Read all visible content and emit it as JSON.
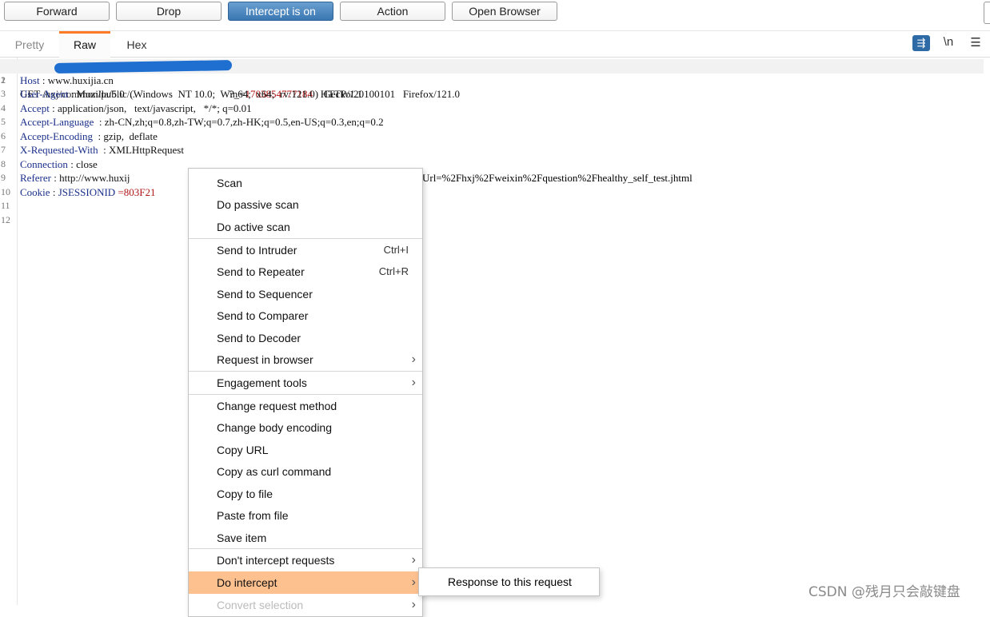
{
  "toolbar": {
    "buttons": [
      "Forward",
      "Drop",
      "Intercept is on",
      "Action",
      "Open Browser"
    ]
  },
  "tabs": [
    "Pretty",
    "Raw",
    "Hex"
  ],
  "view_icons": {
    "wrap": "wrap-lines-icon",
    "newline": "\\n",
    "menu": "☰"
  },
  "request": {
    "line_numbers": [
      "1",
      "2",
      "3",
      "4",
      "5",
      "6",
      "7",
      "8",
      "9",
      "10",
      "11",
      "12"
    ],
    "line1": {
      "method": "GET /",
      "masked": "hxj/common/public/...",
      "param": "?_=",
      "value": "1703854777184",
      "proto": "HTTP/1.1"
    },
    "headers": [
      {
        "name": "Host",
        "sep": " : ",
        "value": "www.huxijia.cn"
      },
      {
        "name": "User-Agent",
        "sep": " : ",
        "value": "Mozilla/5.0  (Windows  NT 10.0;  Win64;  x64;  rv:121.0)  Gecko/20100101   Firefox/121.0"
      },
      {
        "name": "Accept",
        "sep": " : ",
        "value": "application/json,   text/javascript,   */*; q=0.01"
      },
      {
        "name": "Accept-Language",
        "sep": "  : ",
        "value": "zh-CN,zh;q=0.8,zh-TW;q=0.7,zh-HK;q=0.5,en-US;q=0.3,en;q=0.2"
      },
      {
        "name": "Accept-Encoding",
        "sep": "  : ",
        "value": "gzip,  deflate"
      },
      {
        "name": "X-Requested-With",
        "sep": "  : ",
        "value": "XMLHttpRequest"
      },
      {
        "name": "Connection",
        "sep": " : ",
        "value": "close"
      },
      {
        "name": "Referer",
        "sep": " : ",
        "value": "http://www.huxij"
      },
      {
        "name": "Cookie",
        "sep": " : ",
        "value": ""
      }
    ],
    "referer_tail": "Url=%2Fhxj%2Fweixin%2Fquestion%2Fhealthy_self_test.jhtml",
    "cookie_name": "JSESSIONID",
    "cookie_value": "=803F21"
  },
  "context_menu": {
    "groups": [
      [
        {
          "label": "Scan"
        },
        {
          "label": "Do passive scan"
        },
        {
          "label": "Do active scan"
        }
      ],
      [
        {
          "label": "Send to Intruder",
          "shortcut": "Ctrl+I"
        },
        {
          "label": "Send to Repeater",
          "shortcut": "Ctrl+R"
        },
        {
          "label": "Send to Sequencer"
        },
        {
          "label": "Send to Comparer"
        },
        {
          "label": "Send to Decoder"
        },
        {
          "label": "Request in browser",
          "arrow": "›"
        }
      ],
      [
        {
          "label": "Engagement tools",
          "arrow": "›"
        }
      ],
      [
        {
          "label": "Change request method"
        },
        {
          "label": "Change body encoding"
        },
        {
          "label": "Copy URL"
        },
        {
          "label": "Copy as curl command"
        },
        {
          "label": "Copy to file"
        },
        {
          "label": "Paste from file"
        },
        {
          "label": "Save item"
        }
      ],
      [
        {
          "label": "Don't intercept requests",
          "arrow": "›"
        },
        {
          "label": "Do intercept",
          "arrow": "›",
          "highlighted": true
        },
        {
          "label": "Convert selection",
          "arrow": "›",
          "disabled": true
        }
      ]
    ]
  },
  "submenu": {
    "label": "Response to this request"
  },
  "watermark": "CSDN @残月只会敲键盘",
  "colors": {
    "accent_tab": "#ff7a24",
    "intercept_on": "#3a77b2",
    "menu_highlight": "#fdc08f",
    "header_name": "#1a2f8a",
    "value_red": "#b01818"
  }
}
